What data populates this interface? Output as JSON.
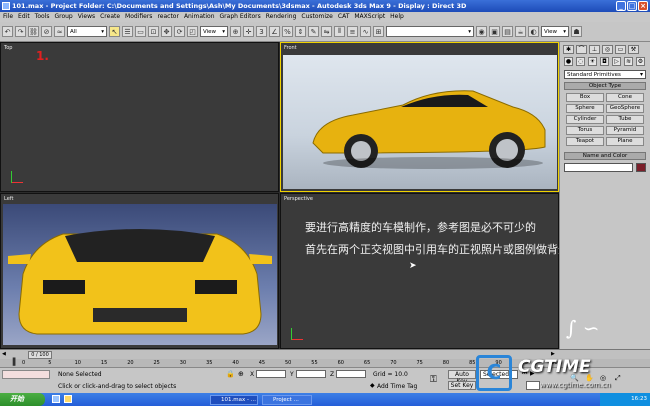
{
  "window": {
    "title": "101.max   -  Project Folder: C:\\Documents and Settings\\Ash\\My Documents\\3dsmax   -  Autodesk 3ds Max 9      -  Display : Direct 3D"
  },
  "menu": [
    "File",
    "Edit",
    "Tools",
    "Group",
    "Views",
    "Create",
    "Modifiers",
    "reactor",
    "Animation",
    "Graph Editors",
    "Rendering",
    "Customize",
    "CAT",
    "MAXScript",
    "Help"
  ],
  "toolbar": {
    "selection_filter": "All",
    "coord_system": "View",
    "named_selection": "",
    "render_view": "View"
  },
  "viewports": {
    "top": {
      "label": "Top",
      "annotation": "1."
    },
    "front": {
      "label": "Front"
    },
    "left": {
      "label": "Left"
    },
    "perspective": {
      "label": "Perspective"
    }
  },
  "caption": {
    "line1": "要进行高精度的车模制作，参考图是必不可少的",
    "line2": "首先在两个正交视图中引用车的正视照片或图例做背景"
  },
  "command_panel": {
    "category": "Standard Primitives",
    "object_type_title": "Object Type",
    "object_buttons": [
      "Box",
      "Cone",
      "Sphere",
      "GeoSphere",
      "Cylinder",
      "Tube",
      "Torus",
      "Pyramid",
      "Teapot",
      "Plane"
    ],
    "name_color_title": "Name and Color",
    "name_value": "",
    "accent_color": "#7a1f2a"
  },
  "timeline": {
    "slider_label": "0 / 100",
    "ticks": [
      "0",
      "5",
      "10",
      "15",
      "20",
      "25",
      "30",
      "35",
      "40",
      "45",
      "50",
      "55",
      "60",
      "65",
      "70",
      "75",
      "80",
      "85",
      "90",
      "95",
      "100"
    ]
  },
  "status": {
    "selection": "None Selected",
    "prompt": "Click or click-and-drag to select objects",
    "x_label": "X",
    "y_label": "Y",
    "z_label": "Z",
    "grid": "Grid = 10.0",
    "auto_key": "Auto Key",
    "set_key": "Set Key",
    "add_time_tag": "Add Time Tag",
    "selected": "Selected"
  },
  "taskbar": {
    "start": "开始",
    "tasks": [
      "101.max - ...",
      "Project ..."
    ],
    "clock": "16:23"
  },
  "watermark": {
    "text": "CGTIME",
    "url": "www.cgtime.com.cn"
  }
}
